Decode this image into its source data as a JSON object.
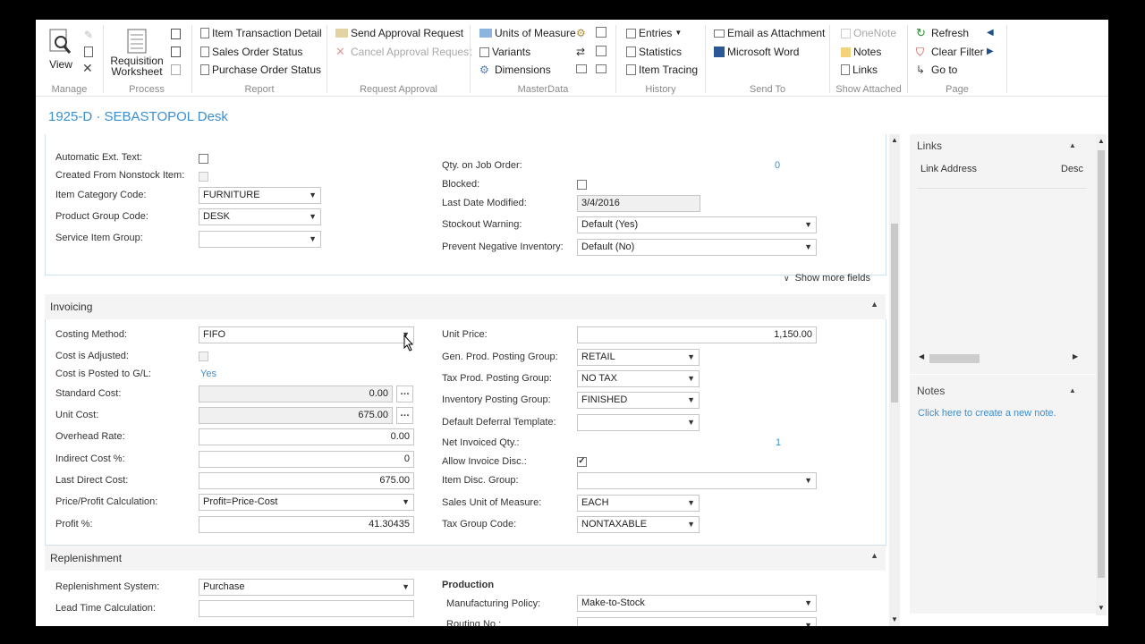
{
  "ribbon": {
    "manage": {
      "label": "Manage",
      "view": "View"
    },
    "process": {
      "label": "Process",
      "requisition_line1": "Requisition",
      "requisition_line2": "Worksheet"
    },
    "report": {
      "label": "Report",
      "items": [
        "Item Transaction Detail",
        "Sales Order Status",
        "Purchase Order Status"
      ]
    },
    "request_approval": {
      "label": "Request Approval",
      "send": "Send Approval Request",
      "cancel": "Cancel Approval Request"
    },
    "masterdata": {
      "label": "MasterData",
      "items": [
        "Units of Measure",
        "Variants",
        "Dimensions"
      ]
    },
    "history": {
      "label": "History",
      "items": [
        "Entries",
        "Statistics",
        "Item Tracing"
      ]
    },
    "send_to": {
      "label": "Send To",
      "items": [
        "Email as Attachment",
        "Microsoft Word"
      ]
    },
    "show_attached": {
      "label": "Show Attached",
      "items": [
        "OneNote",
        "Notes",
        "Links"
      ]
    },
    "page": {
      "label": "Page",
      "items": [
        "Refresh",
        "Clear Filter",
        "Go to"
      ]
    }
  },
  "title": "1925-D · SEBASTOPOL Desk",
  "item_section": {
    "left": [
      {
        "label": "Automatic Ext. Text:",
        "type": "check",
        "checked": false
      },
      {
        "label": "Created From Nonstock Item:",
        "type": "check",
        "checked": false,
        "disabled": true
      },
      {
        "label": "Item Category Code:",
        "type": "select",
        "value": "FURNITURE"
      },
      {
        "label": "Product Group Code:",
        "type": "select",
        "value": "DESK"
      },
      {
        "label": "Service Item Group:",
        "type": "select",
        "value": ""
      }
    ],
    "right": {
      "qty_job_label": "Qty. on Job Order:",
      "qty_job_value": "0",
      "blocked_label": "Blocked:",
      "last_modified_label": "Last Date Modified:",
      "last_modified_value": "3/4/2016",
      "stockout_label": "Stockout Warning:",
      "stockout_value": "Default (Yes)",
      "negative_inv_label": "Prevent Negative Inventory:",
      "negative_inv_value": "Default (No)"
    },
    "show_more": "Show more fields"
  },
  "invoicing": {
    "title": "Invoicing",
    "costing_method_label": "Costing Method:",
    "costing_method_value": "FIFO",
    "cost_adjusted_label": "Cost is Adjusted:",
    "cost_posted_label": "Cost is Posted to G/L:",
    "cost_posted_value": "Yes",
    "standard_cost_label": "Standard Cost:",
    "standard_cost_value": "0.00",
    "unit_cost_label": "Unit Cost:",
    "unit_cost_value": "675.00",
    "overhead_label": "Overhead Rate:",
    "overhead_value": "0.00",
    "indirect_label": "Indirect Cost %:",
    "indirect_value": "0",
    "last_direct_label": "Last Direct Cost:",
    "last_direct_value": "675.00",
    "price_profit_label": "Price/Profit Calculation:",
    "price_profit_value": "Profit=Price-Cost",
    "profit_label": "Profit %:",
    "profit_value": "41.30435",
    "unit_price_label": "Unit Price:",
    "unit_price_value": "1,150.00",
    "gen_prod_label": "Gen. Prod. Posting Group:",
    "gen_prod_value": "RETAIL",
    "tax_prod_label": "Tax Prod. Posting Group:",
    "tax_prod_value": "NO TAX",
    "inv_posting_label": "Inventory Posting Group:",
    "inv_posting_value": "FINISHED",
    "deferral_label": "Default Deferral Template:",
    "deferral_value": "",
    "net_invoiced_label": "Net Invoiced Qty.:",
    "net_invoiced_value": "1",
    "allow_disc_label": "Allow Invoice Disc.:",
    "item_disc_label": "Item Disc. Group:",
    "item_disc_value": "",
    "sales_uom_label": "Sales Unit of Measure:",
    "sales_uom_value": "EACH",
    "tax_group_label": "Tax Group Code:",
    "tax_group_value": "NONTAXABLE"
  },
  "replenishment": {
    "title": "Replenishment",
    "system_label": "Replenishment System:",
    "system_value": "Purchase",
    "lead_time_label": "Lead Time Calculation:",
    "lead_time_value": "",
    "production_label": "Production",
    "mfg_policy_label": "Manufacturing Policy:",
    "mfg_policy_value": "Make-to-Stock",
    "routing_label": "Routing No.:"
  },
  "factbox": {
    "links_title": "Links",
    "link_address": "Link Address",
    "desc": "Desc",
    "notes_title": "Notes",
    "new_note": "Click here to create a new note."
  },
  "colors": {
    "accent": "#3a8fd0",
    "section_border": "#cfe0ef"
  }
}
